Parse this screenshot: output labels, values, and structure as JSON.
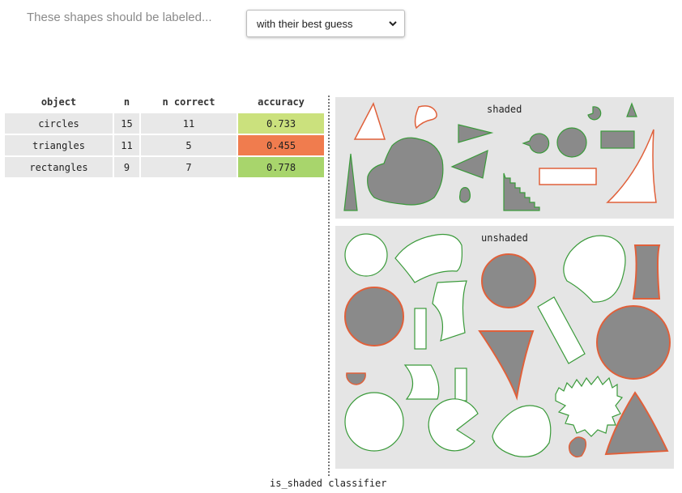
{
  "prompt": {
    "label": "These shapes should be labeled...",
    "dropdown_value": "with their best guess",
    "dropdown_icon": "chevron-down-icon"
  },
  "table": {
    "headers": [
      "object",
      "n",
      "n correct",
      "accuracy"
    ],
    "rows": [
      {
        "object": "circles",
        "n": "15",
        "n_correct": "11",
        "accuracy": "0.733",
        "accuracy_color": "#cbe17d"
      },
      {
        "object": "triangles",
        "n": "11",
        "n_correct": "5",
        "accuracy": "0.455",
        "accuracy_color": "#f07c4e"
      },
      {
        "object": "rectangles",
        "n": "9",
        "n_correct": "7",
        "accuracy": "0.778",
        "accuracy_color": "#a8d56c"
      }
    ]
  },
  "panels": {
    "shaded": {
      "title": "shaded"
    },
    "unshaded": {
      "title": "unshaded"
    }
  },
  "colors": {
    "correct_outline": "#3a9a3a",
    "incorrect_outline": "#e0603a",
    "fill_shaded": "#8a8a8a",
    "panel_bg": "#e5e5e5"
  },
  "caption": "is_shaded classifier"
}
